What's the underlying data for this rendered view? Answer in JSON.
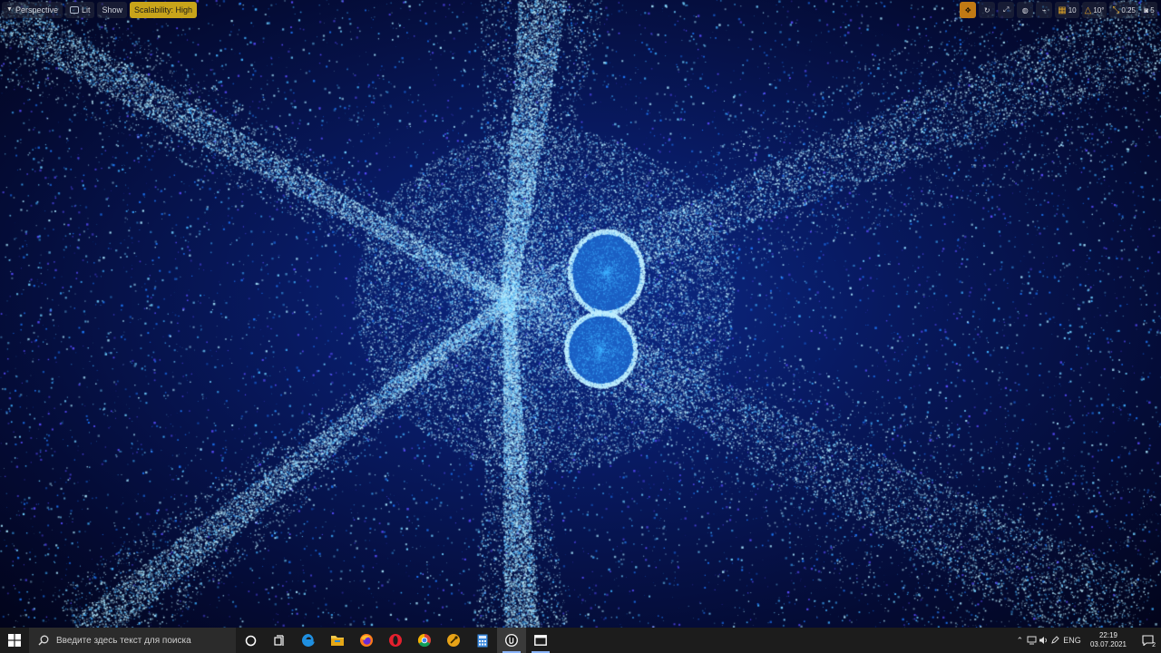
{
  "viewport": {
    "toolbar_left": {
      "perspective": "Perspective",
      "lit": "Lit",
      "show": "Show",
      "scalability": "Scalability: High"
    },
    "toolbar_right": {
      "grid_snap": "10",
      "angle_snap": "10°",
      "scale_snap": "0.25",
      "camera_speed": "5"
    },
    "scene": {
      "particle_colors": [
        "#1e7bff",
        "#3fb0ff",
        "#6fd0ff",
        "#a8e8ff",
        "#5a4dff"
      ],
      "glow_color": "#bff0ff"
    }
  },
  "taskbar": {
    "search_placeholder": "Введите здесь текст для поиска",
    "apps": [
      "windows-icon",
      "task-view-icon",
      "edge-icon",
      "file-explorer-icon",
      "firefox-icon",
      "opera-icon",
      "chrome-icon",
      "app-icon",
      "calculator-icon",
      "unreal-engine-icon",
      "window-icon"
    ],
    "tray": {
      "language": "ENG",
      "time": "22:19",
      "date": "03.07.2021",
      "notifications_count": "2"
    }
  }
}
